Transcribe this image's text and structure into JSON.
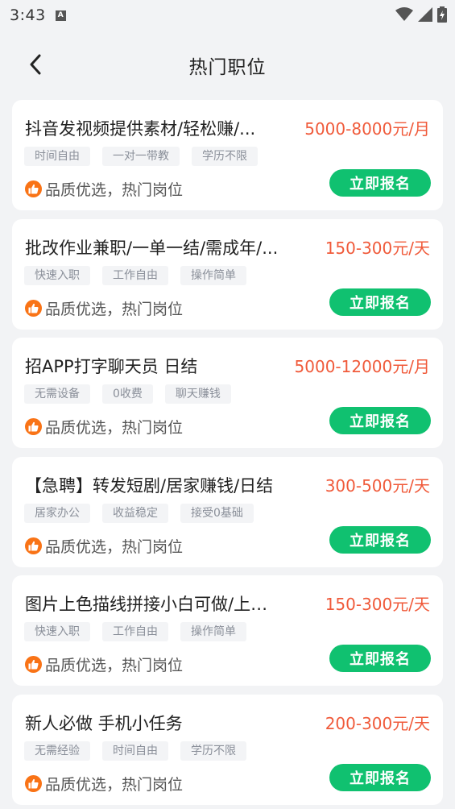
{
  "status": {
    "time": "3:43",
    "a_icon": "A"
  },
  "header": {
    "title": "热门职位"
  },
  "quality_text": "品质优选，热门岗位",
  "apply_label": "立即报名",
  "jobs": [
    {
      "title": "抖音发视频提供素材/轻松赚/...",
      "salary": "5000-8000元/月",
      "tags": [
        "时间自由",
        "一对一带教",
        "学历不限"
      ]
    },
    {
      "title": "批改作业兼职/一单一结/需成年/...",
      "salary": "150-300元/天",
      "tags": [
        "快速入职",
        "工作自由",
        "操作简单"
      ]
    },
    {
      "title": "招APP打字聊天员 日结",
      "salary": "5000-12000元/月",
      "tags": [
        "无需设备",
        "0收费",
        "聊天赚钱"
      ]
    },
    {
      "title": "【急聘】转发短剧/居家赚钱/日结",
      "salary": "300-500元/天",
      "tags": [
        "居家办公",
        "收益稳定",
        "接受0基础"
      ]
    },
    {
      "title": "图片上色描线拼接小白可做/上…",
      "salary": "150-300元/天",
      "tags": [
        "快速入职",
        "工作自由",
        "操作简单"
      ]
    },
    {
      "title": "新人必做 手机小任务",
      "salary": "200-300元/天",
      "tags": [
        "无需经验",
        "时间自由",
        "学历不限"
      ]
    }
  ],
  "colors": {
    "salary": "#f05a3a",
    "apply_button": "#10c170",
    "thumb_badge": "#f97316"
  },
  "icons": {
    "back": "chevron-left-icon",
    "thumb": "thumbs-up-icon",
    "wifi": "wifi-icon",
    "signal": "signal-icon",
    "battery": "battery-icon"
  }
}
